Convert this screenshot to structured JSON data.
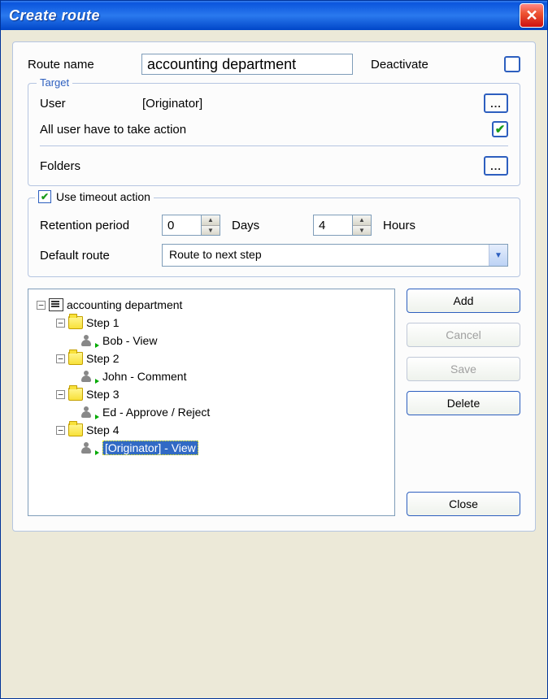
{
  "window": {
    "title": "Create route"
  },
  "form": {
    "route_name_label": "Route name",
    "route_name_value": "accounting department",
    "deactivate_label": "Deactivate",
    "deactivate_checked": false
  },
  "target": {
    "legend": "Target",
    "user_label": "User",
    "user_value": "[Originator]",
    "browse_user": "...",
    "all_user_label": "All user have to take action",
    "all_user_checked": true,
    "folders_label": "Folders",
    "browse_folders": "..."
  },
  "timeout": {
    "use_label": "Use timeout action",
    "use_checked": true,
    "retention_label": "Retention period",
    "days_value": "0",
    "days_label": "Days",
    "hours_value": "4",
    "hours_label": "Hours",
    "default_route_label": "Default route",
    "default_route_value": "Route to next step"
  },
  "tree": {
    "root": "accounting department",
    "steps": [
      {
        "name": "Step 1",
        "user": "Bob - View"
      },
      {
        "name": "Step 2",
        "user": "John - Comment"
      },
      {
        "name": "Step 3",
        "user": "Ed - Approve / Reject"
      },
      {
        "name": "Step 4",
        "user": "[Originator] - View",
        "selected": true
      }
    ]
  },
  "buttons": {
    "add": "Add",
    "cancel": "Cancel",
    "save": "Save",
    "delete": "Delete",
    "close": "Close"
  }
}
